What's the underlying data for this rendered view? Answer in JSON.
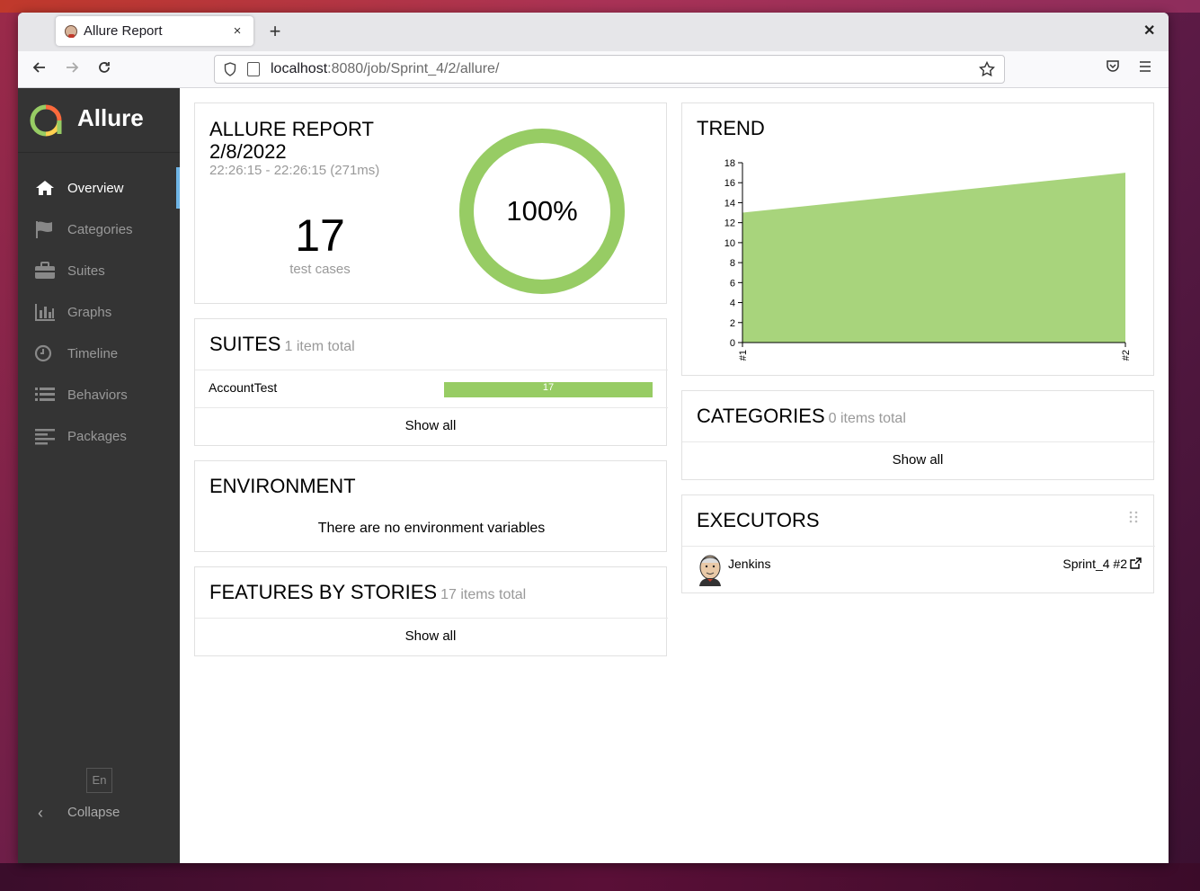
{
  "browser": {
    "tab_title": "Allure Report",
    "new_tab": "+",
    "tab_close": "×",
    "window_close": "✕",
    "url_host": "localhost",
    "url_path": ":8080/job/Sprint_4/2/allure/"
  },
  "sidebar": {
    "brand": "Allure",
    "items": [
      {
        "label": "Overview",
        "icon": "home-icon",
        "active": true
      },
      {
        "label": "Categories",
        "icon": "flag-icon"
      },
      {
        "label": "Suites",
        "icon": "briefcase-icon"
      },
      {
        "label": "Graphs",
        "icon": "bar-chart-icon"
      },
      {
        "label": "Timeline",
        "icon": "clock-icon"
      },
      {
        "label": "Behaviors",
        "icon": "list-icon"
      },
      {
        "label": "Packages",
        "icon": "align-left-icon"
      }
    ],
    "language": "En",
    "collapse": "Collapse"
  },
  "summary": {
    "title_line1": "ALLURE REPORT",
    "title_line2": "2/8/2022",
    "time_range": "22:26:15 - 22:26:15 (271ms)",
    "count": "17",
    "count_label": "test cases",
    "percent": "100%",
    "pass_fraction": 1.0,
    "pass_color": "#97cc64"
  },
  "suites": {
    "title": "SUITES",
    "subtitle": "1 item total",
    "rows": [
      {
        "name": "AccountTest",
        "passed": "17"
      }
    ],
    "show_all": "Show all"
  },
  "environment": {
    "title": "ENVIRONMENT",
    "message": "There are no environment variables"
  },
  "features": {
    "title": "FEATURES BY STORIES",
    "subtitle": "17 items total",
    "show_all": "Show all"
  },
  "trend": {
    "title": "TREND"
  },
  "categories": {
    "title": "CATEGORIES",
    "subtitle": "0 items total",
    "show_all": "Show all"
  },
  "executors": {
    "title": "EXECUTORS",
    "name": "Jenkins",
    "build": "Sprint_4 #2"
  },
  "chart_data": {
    "type": "area",
    "x": [
      "#1",
      "#2"
    ],
    "series": [
      {
        "values": [
          13,
          17
        ]
      }
    ],
    "ylim": [
      0,
      18
    ],
    "yticks": [
      "0",
      "2",
      "4",
      "6",
      "8",
      "10",
      "12",
      "14",
      "16",
      "18"
    ],
    "color": "#a8d47c"
  }
}
